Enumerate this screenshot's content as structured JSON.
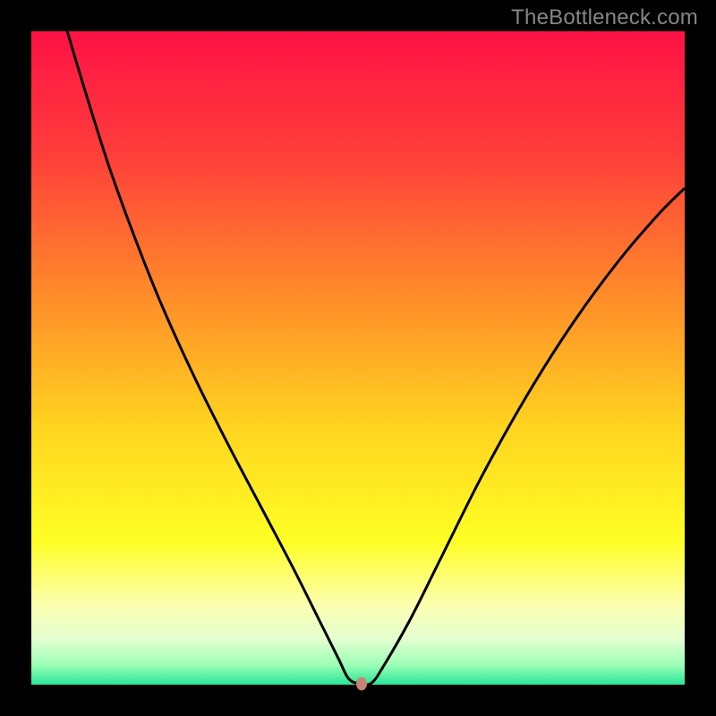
{
  "watermark": "TheBottleneck.com",
  "marker": {
    "color": "#ca8277",
    "x_fraction": 0.505,
    "y_fraction": 0.998
  },
  "chart_data": {
    "type": "line",
    "title": "",
    "xlabel": "",
    "ylabel": "",
    "xlim": [
      0,
      1
    ],
    "ylim": [
      0,
      1
    ],
    "background": {
      "type": "vertical-gradient",
      "stops": [
        {
          "pos": 0.0,
          "color": "#ff1245"
        },
        {
          "pos": 0.18,
          "color": "#ff3b3b"
        },
        {
          "pos": 0.4,
          "color": "#ff8a2a"
        },
        {
          "pos": 0.6,
          "color": "#ffd21f"
        },
        {
          "pos": 0.78,
          "color": "#ffff25"
        },
        {
          "pos": 0.88,
          "color": "#fcffb2"
        },
        {
          "pos": 0.93,
          "color": "#e4ffd0"
        },
        {
          "pos": 0.97,
          "color": "#9bffb6"
        },
        {
          "pos": 1.0,
          "color": "#28e597"
        }
      ]
    },
    "series": [
      {
        "name": "bottleneck-curve",
        "color": "#000000",
        "width": 3,
        "points": [
          {
            "x": 0.055,
            "y": 1.0
          },
          {
            "x": 0.085,
            "y": 0.9
          },
          {
            "x": 0.12,
            "y": 0.79
          },
          {
            "x": 0.16,
            "y": 0.68
          },
          {
            "x": 0.2,
            "y": 0.58
          },
          {
            "x": 0.25,
            "y": 0.47
          },
          {
            "x": 0.3,
            "y": 0.37
          },
          {
            "x": 0.35,
            "y": 0.275
          },
          {
            "x": 0.4,
            "y": 0.18
          },
          {
            "x": 0.44,
            "y": 0.1
          },
          {
            "x": 0.47,
            "y": 0.04
          },
          {
            "x": 0.485,
            "y": 0.01
          },
          {
            "x": 0.5,
            "y": 0.002
          },
          {
            "x": 0.52,
            "y": 0.002
          },
          {
            "x": 0.54,
            "y": 0.03
          },
          {
            "x": 0.58,
            "y": 0.1
          },
          {
            "x": 0.63,
            "y": 0.2
          },
          {
            "x": 0.69,
            "y": 0.32
          },
          {
            "x": 0.76,
            "y": 0.445
          },
          {
            "x": 0.83,
            "y": 0.555
          },
          {
            "x": 0.9,
            "y": 0.65
          },
          {
            "x": 0.96,
            "y": 0.72
          },
          {
            "x": 1.0,
            "y": 0.76
          }
        ]
      }
    ],
    "markers": [
      {
        "name": "optimal-point",
        "x": 0.505,
        "y": 0.002,
        "color": "#ca8277"
      }
    ]
  }
}
